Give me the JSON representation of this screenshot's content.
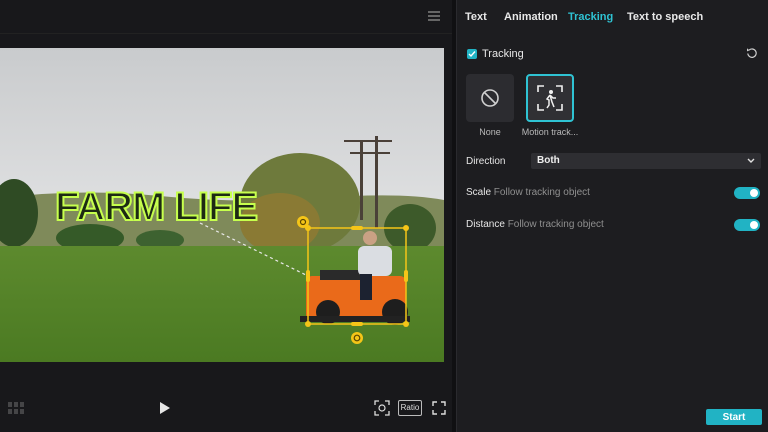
{
  "overlay": {
    "text": "FARM LIFE"
  },
  "preview": {
    "ratio_label": "Ratio"
  },
  "tabs": [
    {
      "label": "Text"
    },
    {
      "label": "Animation"
    },
    {
      "label": "Tracking",
      "active": true
    },
    {
      "label": "Text to speech"
    }
  ],
  "tracking": {
    "label": "Tracking",
    "checked": true,
    "options": [
      {
        "label": "None",
        "icon": "none-icon",
        "selected": false
      },
      {
        "label": "Motion track...",
        "icon": "motion-tracking-icon",
        "selected": true
      }
    ],
    "direction": {
      "label": "Direction",
      "value": "Both"
    },
    "scale": {
      "label": "Scale",
      "sub": "Follow tracking object",
      "enabled": true
    },
    "distance": {
      "label": "Distance",
      "sub": "Follow tracking object",
      "enabled": true
    }
  },
  "footer": {
    "start_label": "Start"
  },
  "colors": {
    "accent": "#21b3c4",
    "active_tab": "#2fc3d3",
    "selection": "#f5c518"
  }
}
